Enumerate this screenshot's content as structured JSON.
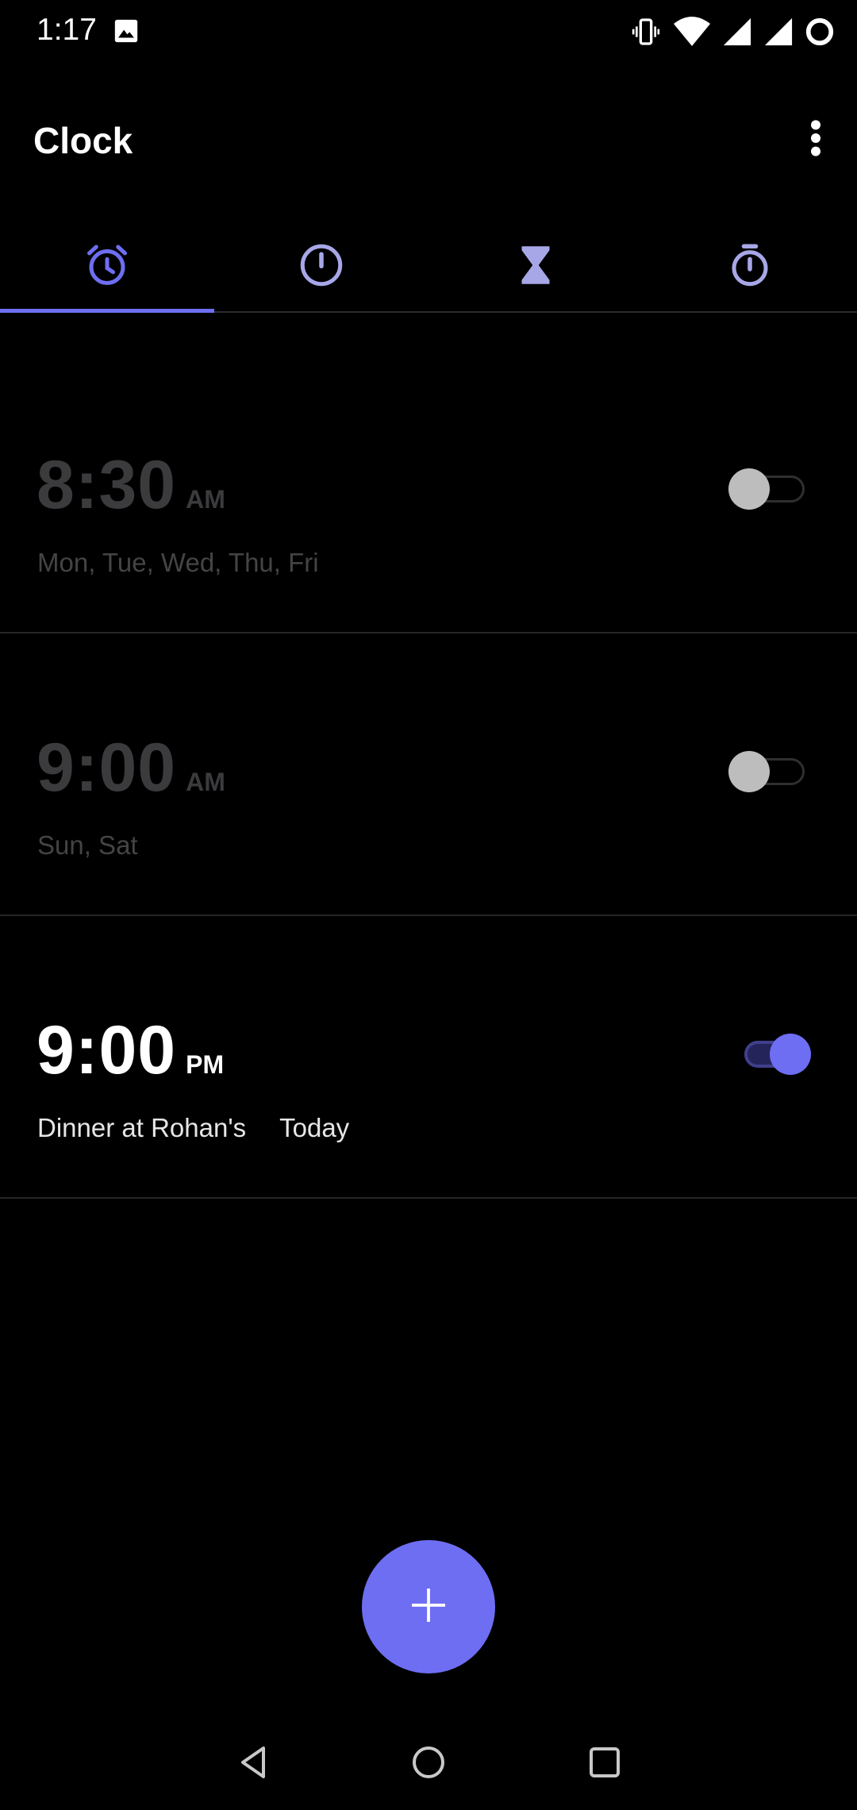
{
  "status_bar": {
    "time": "1:17",
    "icons": [
      "photo-icon",
      "vibrate-icon",
      "wifi-icon",
      "cell-signal-icon",
      "cell-signal-icon",
      "battery-ring-icon"
    ]
  },
  "app_bar": {
    "title": "Clock",
    "menu_icon": "more-vert-icon"
  },
  "tabs": [
    {
      "icon": "alarm-clock-icon",
      "selected": true
    },
    {
      "icon": "clock-icon",
      "selected": false
    },
    {
      "icon": "hourglass-icon",
      "selected": false
    },
    {
      "icon": "stopwatch-icon",
      "selected": false
    }
  ],
  "alarms": [
    {
      "time": "8:30",
      "ampm": "AM",
      "label": "",
      "repeat": "Mon, Tue, Wed, Thu, Fri",
      "enabled": false
    },
    {
      "time": "9:00",
      "ampm": "AM",
      "label": "",
      "repeat": "Sun, Sat",
      "enabled": false
    },
    {
      "time": "9:00",
      "ampm": "PM",
      "label": "Dinner at Rohan's",
      "repeat": "Today",
      "enabled": true
    }
  ],
  "fab": {
    "icon": "plus-icon"
  },
  "nav_bar": {
    "icons": [
      "back-icon",
      "home-icon",
      "recents-icon"
    ]
  },
  "colors": {
    "accent": "#6e6ef3",
    "background": "#000000",
    "disabled_text": "#3b3b3d",
    "divider": "#262629"
  }
}
